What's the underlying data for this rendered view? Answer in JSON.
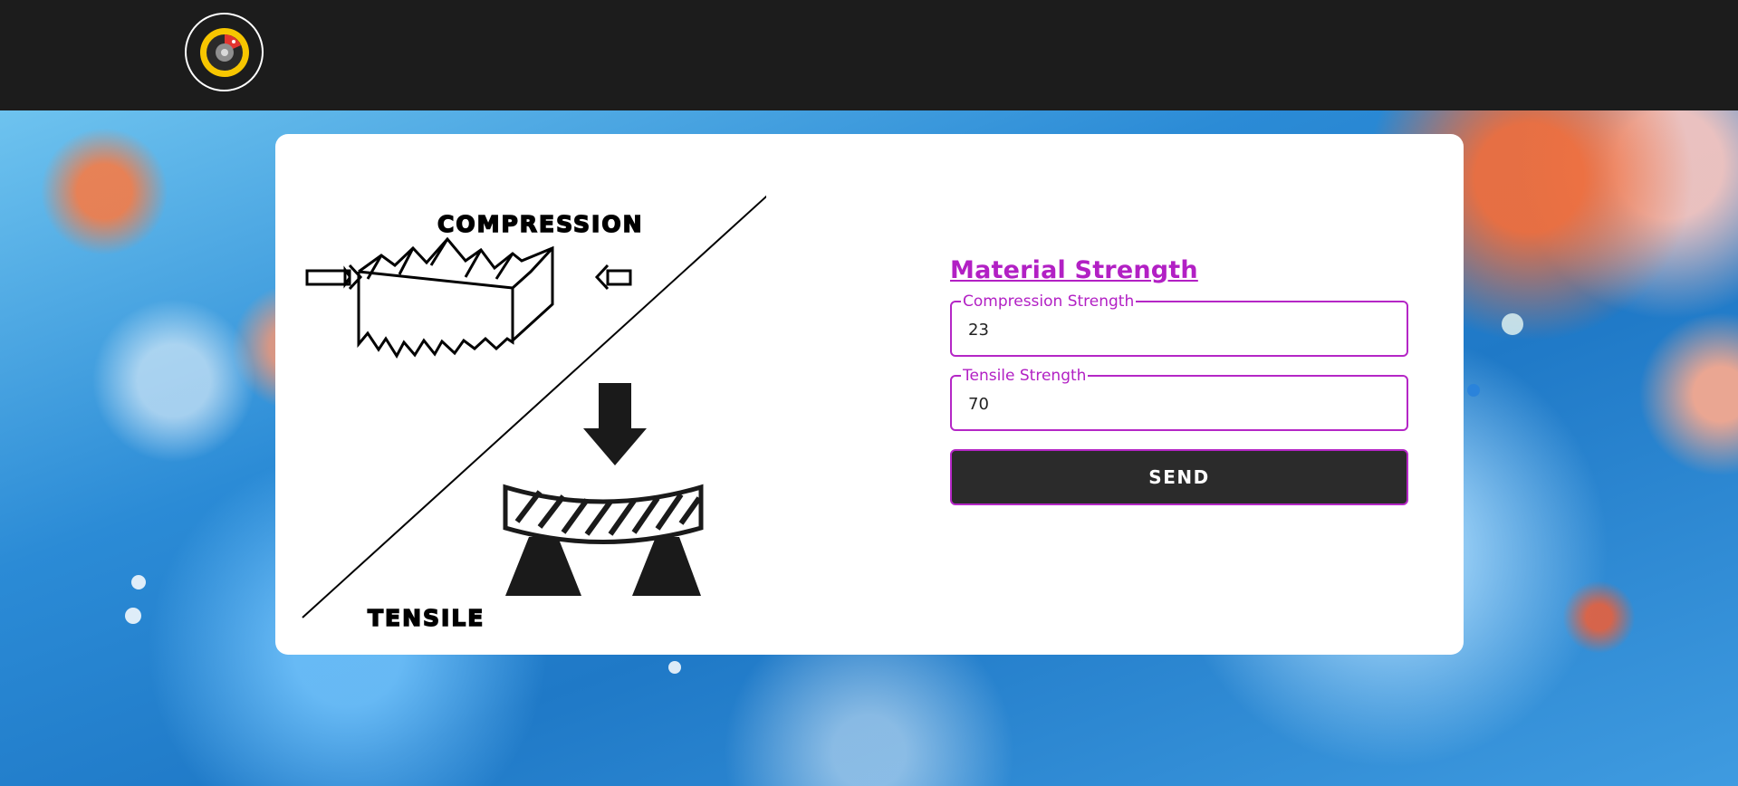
{
  "header": {
    "logo_icon": "gauge-logo-icon"
  },
  "illustration": {
    "compression_label": "COMPRESSION",
    "tensile_label": "TENSILE"
  },
  "form": {
    "title": "Material Strength",
    "compression": {
      "label": "Compression Strength",
      "value": "23"
    },
    "tensile": {
      "label": "Tensile Strength",
      "value": "70"
    },
    "send_label": "SEND"
  },
  "colors": {
    "accent": "#b220c4",
    "header_bg": "#1c1c1c",
    "button_bg": "#2b2b2b"
  }
}
